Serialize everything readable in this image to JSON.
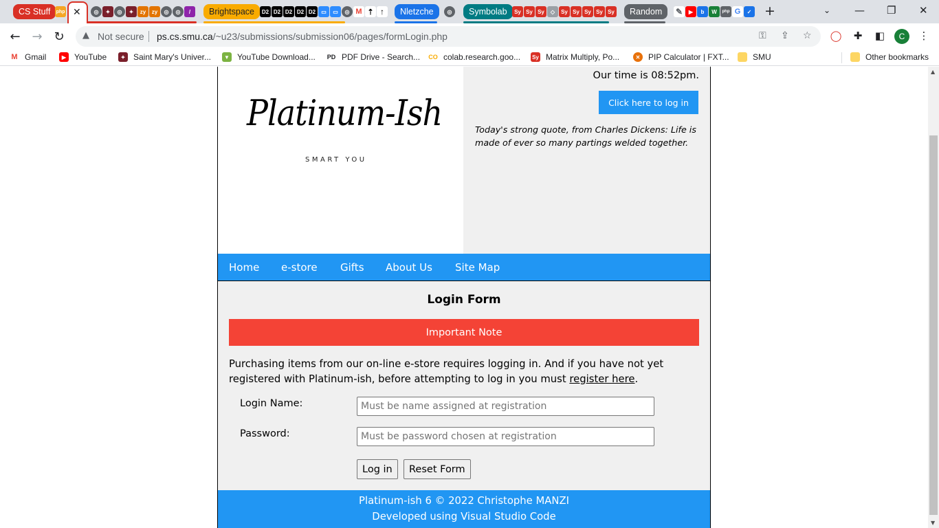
{
  "browser": {
    "tab_groups": [
      {
        "label": "CS Stuff",
        "color": "#d93025"
      },
      {
        "label": "Brightspace",
        "color": "#f9ab00"
      },
      {
        "label": "Nletzche",
        "color": "#1a73e8"
      },
      {
        "label": "Symbolab",
        "color": "#007b83"
      },
      {
        "label": "Random",
        "color": "#5f6368"
      }
    ],
    "address": {
      "security_label": "Not secure",
      "host": "ps.cs.smu.ca",
      "path": "/~u23/submissions/submission06/pages/formLogin.php"
    },
    "profile_initial": "C",
    "bookmarks": [
      {
        "label": "Gmail",
        "icon": "gmail-icon",
        "color": "#ea4335"
      },
      {
        "label": "YouTube",
        "icon": "youtube-icon",
        "color": "#ff0000"
      },
      {
        "label": "Saint Mary's Univer...",
        "icon": "smu-crest-icon",
        "color": "#7a1f2b"
      },
      {
        "label": "YouTube Download...",
        "icon": "download-arrow-icon",
        "color": "#7cb342"
      },
      {
        "label": "PDF Drive - Search...",
        "icon": "pdf-drive-icon",
        "color": "#202124"
      },
      {
        "label": "colab.research.goo...",
        "icon": "colab-icon",
        "color": "#f9ab00"
      },
      {
        "label": "Matrix Multiply, Po...",
        "icon": "symbolab-icon",
        "color": "#d93025"
      },
      {
        "label": "PIP Calculator | FXT...",
        "icon": "pip-calculator-icon",
        "color": "#e8710a"
      },
      {
        "label": "SMU",
        "icon": "folder-icon",
        "color": "#fdd663"
      },
      {
        "label": "Other bookmarks",
        "icon": "folder-icon",
        "color": "#fdd663"
      }
    ]
  },
  "site": {
    "logo_text": "Platinum-Ish",
    "logo_tagline": "SMART YOU",
    "time_text": "Our time is 08:52pm.",
    "login_link_label": "Click here to log in",
    "quote_text": "Today's strong quote, from Charles Dickens: Life is made of ever so many partings welded together.",
    "nav": [
      "Home",
      "e-store",
      "Gifts",
      "About Us",
      "Site Map"
    ],
    "form_title": "Login Form",
    "note_label": "Important Note",
    "note_text_before": "Purchasing items from our on-line e-store requires logging in. And if you have not yet registered with Platinum-ish, before attempting to log in you must ",
    "note_link": "register here",
    "note_text_after": ".",
    "login_name_label": "Login Name:",
    "login_name_placeholder": "Must be name assigned at registration",
    "password_label": "Password:",
    "password_placeholder": "Must be password chosen at registration",
    "submit_label": "Log in",
    "reset_label": "Reset Form",
    "footer_line1": "Platinum-ish 6 © 2022 Christophe MANZI",
    "footer_line2": "Developed using Visual Studio Code"
  },
  "colors": {
    "accent": "#2196f3",
    "note": "#f44336",
    "panel": "#f0f0f0"
  }
}
